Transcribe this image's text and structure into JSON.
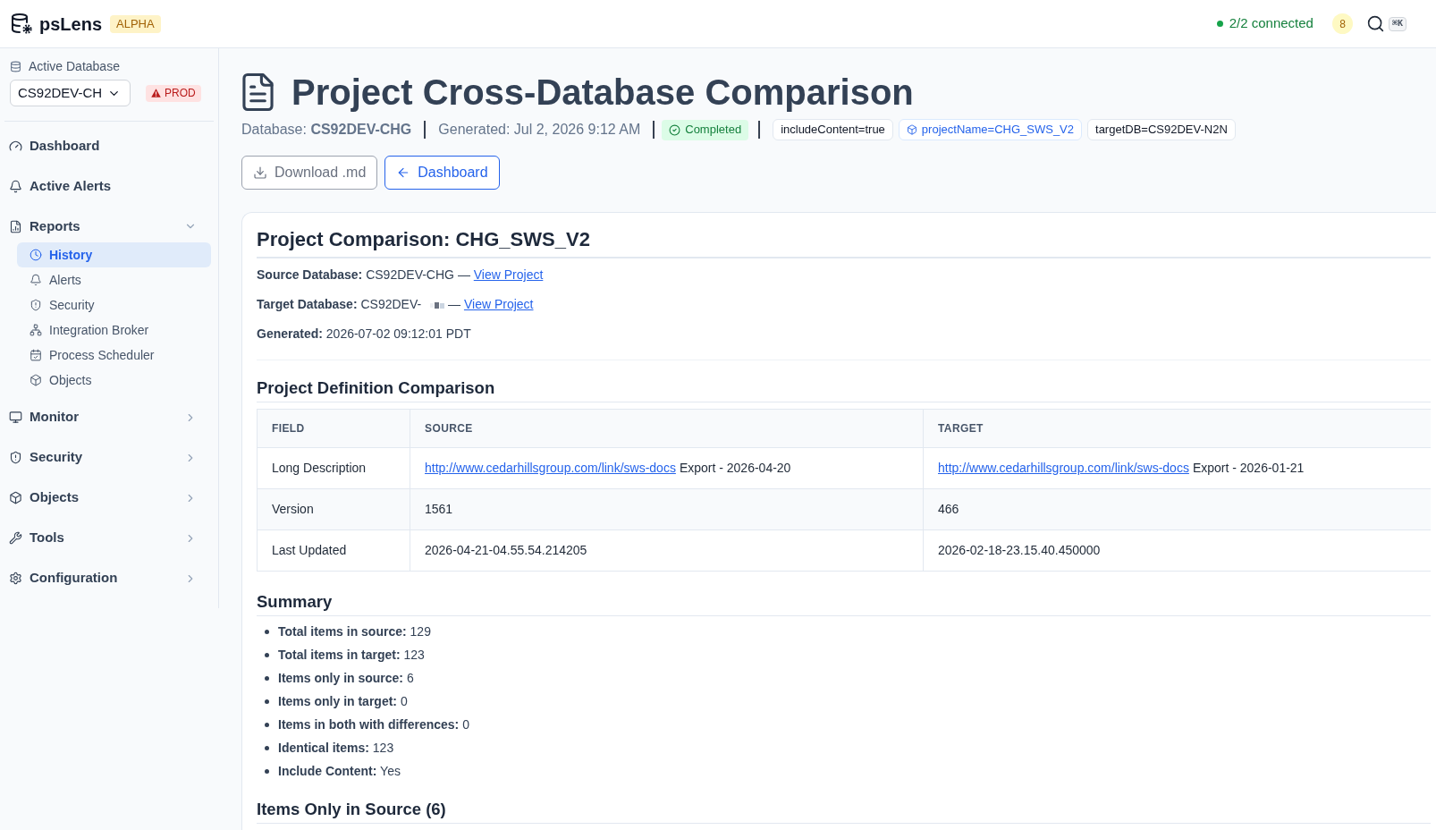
{
  "app": {
    "name": "psLens",
    "badge": "ALPHA"
  },
  "header": {
    "connection": {
      "label": "2/2 connected",
      "connected": true
    },
    "notifications": "8",
    "shortcut": "⌘K"
  },
  "sidebar": {
    "database": {
      "label": "Active Database",
      "value": "CS92DEV-CH",
      "environment": {
        "label": "PROD",
        "kind": "danger"
      }
    },
    "items": [
      {
        "kind": "link",
        "label": "Dashboard",
        "selected": false
      },
      {
        "kind": "link",
        "label": "Active Alerts",
        "selected": false
      },
      {
        "kind": "group",
        "label": "Reports",
        "selected": false,
        "expanded": true,
        "children": [
          {
            "label": "History",
            "selected": true
          },
          {
            "label": "Alerts",
            "selected": false
          },
          {
            "label": "Security",
            "selected": false
          },
          {
            "label": "Integration Broker",
            "selected": false
          },
          {
            "label": "Process Scheduler",
            "selected": false
          },
          {
            "label": "Objects",
            "selected": false
          }
        ]
      },
      {
        "kind": "group",
        "label": "Monitor",
        "selected": false,
        "expanded": false
      },
      {
        "kind": "group",
        "label": "Security",
        "selected": false,
        "expanded": false
      },
      {
        "kind": "group",
        "label": "Objects",
        "selected": false,
        "expanded": false
      },
      {
        "kind": "group",
        "label": "Tools",
        "selected": false,
        "expanded": false
      },
      {
        "kind": "group",
        "label": "Configuration",
        "selected": false,
        "expanded": false
      }
    ]
  },
  "page": {
    "title": "Project Cross-Database Comparison",
    "database": "Database: **CS92DEV-CHG**",
    "generated": "Generated: Jul 2, 2026 9:12 AM",
    "status": {
      "label": "Completed",
      "kind": "success"
    },
    "parameters": [
      {
        "text": "includeContent=true",
        "highlighted": false
      },
      {
        "text": "projectName=CHG_SWS_V2",
        "highlighted": true
      },
      {
        "text": "targetDB=CS92DEV-N2N",
        "highlighted": false
      }
    ],
    "actions": [
      {
        "label": "Download .md",
        "kind": "secondary"
      },
      {
        "label": "Dashboard",
        "kind": "primary"
      }
    ]
  },
  "report": {
    "title": "Project Comparison: CHG_SWS_V2",
    "details": [
      {
        "text": "**Source Database:** CS92DEV-CHG",
        "redacted": false,
        "separator": "—",
        "link": "View Project"
      },
      {
        "text": "**Target Database:** CS92DEV-",
        "redacted": true,
        "separator": "—",
        "link": "View Project"
      },
      {
        "text": "**Generated:** 2026-07-02 09:12:01 PDT",
        "redacted": false
      }
    ],
    "definition": {
      "heading": "Project Definition Comparison",
      "columns": [
        "FIELD",
        "SOURCE",
        "TARGET"
      ],
      "rows": [
        {
          "field": "Long Description",
          "source": {
            "link": "http://www.cedarhillsgroup.com/link/sws-docs",
            "text": "Export - 2026-04-20"
          },
          "target": {
            "link": "http://www.cedarhillsgroup.com/link/sws-docs",
            "text": "Export - 2026-01-21"
          }
        },
        {
          "field": "Version",
          "source": {
            "text": "1561"
          },
          "target": {
            "text": "466"
          }
        },
        {
          "field": "Last Updated",
          "source": {
            "text": "2026-04-21-04.55.54.214205"
          },
          "target": {
            "text": "2026-02-18-23.15.40.450000"
          }
        }
      ]
    },
    "summary": {
      "heading": "Summary",
      "items": [
        "**Total items in source:** 129",
        "**Total items in target:** 123",
        "**Items only in source:** 6",
        "**Items only in target:** 0",
        "**Items in both with differences:** 0",
        "**Identical items:** 123",
        "**Include Content:** Yes"
      ]
    },
    "only_in_source": {
      "heading": "Items Only in Source (6)"
    }
  }
}
